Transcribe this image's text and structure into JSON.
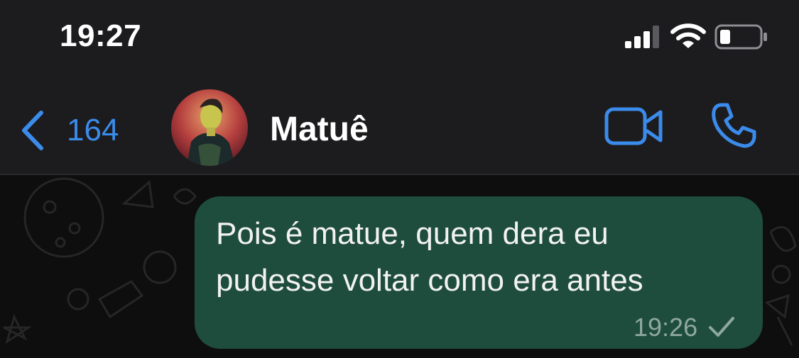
{
  "status_bar": {
    "time": "19:27",
    "icons": [
      "signal-icon",
      "wifi-icon",
      "battery-icon"
    ]
  },
  "header": {
    "back_count": "164",
    "contact_name": "Matuê",
    "icons": [
      "chevron-left-icon",
      "video-call-icon",
      "phone-icon"
    ]
  },
  "message": {
    "text_line1": "Pois é matue, quem dera eu",
    "text_line2": "pudesse voltar como era antes",
    "time": "19:26",
    "status_icon": "single-check-icon"
  },
  "colors": {
    "accent": "#3b8beb",
    "header_bg": "#1c1c1e",
    "chat_bg": "#0e0e0e",
    "outgoing_bubble": "#1f4d3d"
  }
}
